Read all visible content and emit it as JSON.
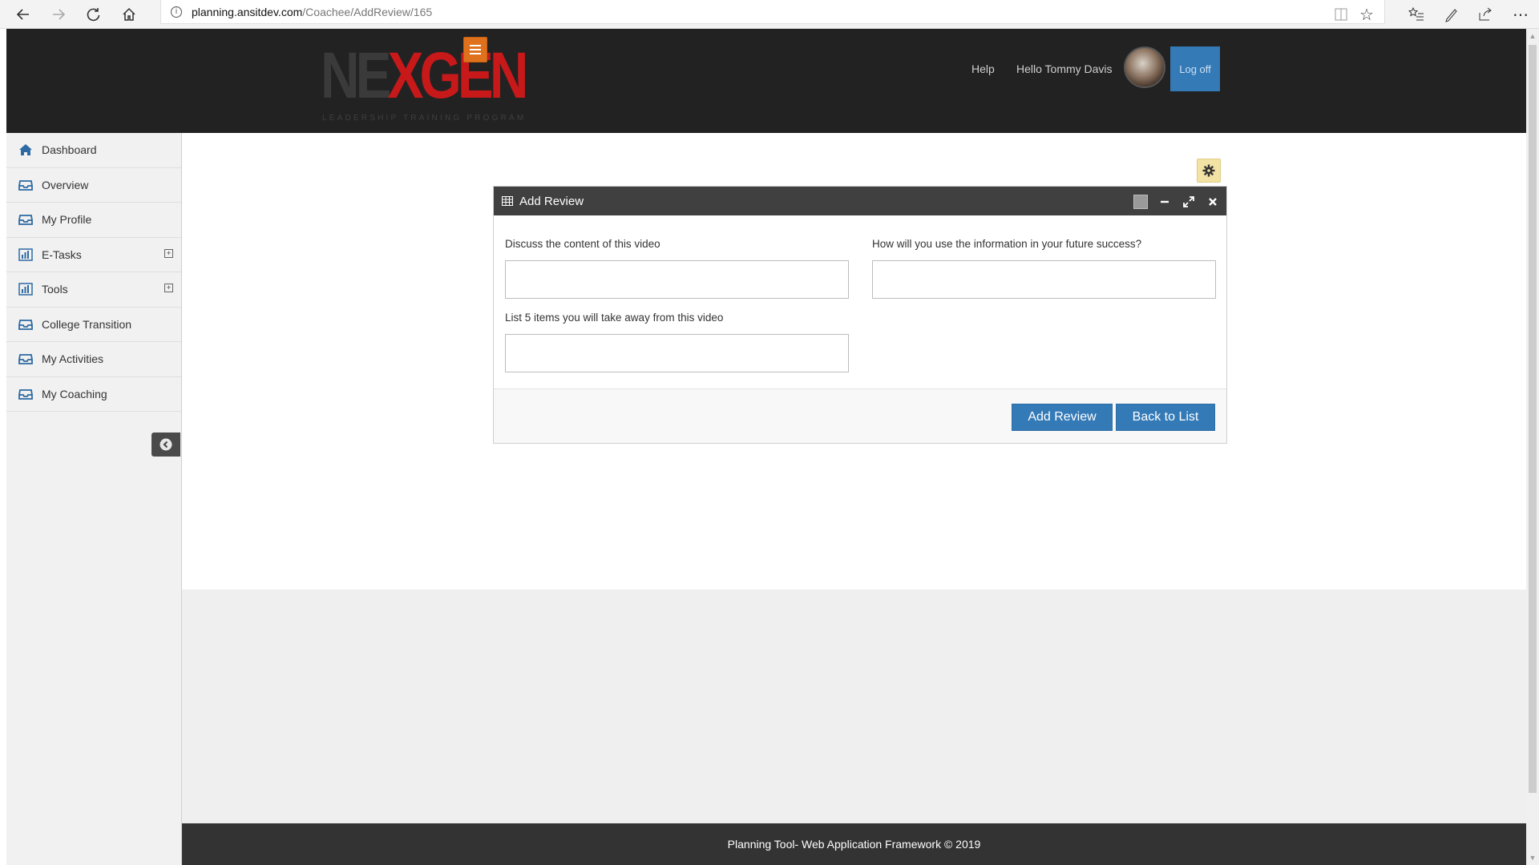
{
  "browser": {
    "url_domain": "planning.ansitdev.com",
    "url_path": "/Coachee/AddReview/165",
    "icons": [
      "back-icon",
      "forward-icon",
      "refresh-icon",
      "home-icon",
      "reading-view-icon",
      "favorite-star-icon",
      "favorites-list-icon",
      "pen-icon",
      "share-icon",
      "more-icon"
    ]
  },
  "header": {
    "logo_part1": "NE",
    "logo_part2": "X",
    "logo_part3": "GEN",
    "logo_subtitle": "LEADERSHIP TRAINING PROGRAM",
    "help_label": "Help",
    "greeting": "Hello Tommy Davis",
    "logoff_label": "Log off",
    "accent_color": "#e0711c",
    "brand_red": "#c8191a"
  },
  "sidebar": {
    "items": [
      {
        "label": "Dashboard",
        "icon": "home-icon"
      },
      {
        "label": "Overview",
        "icon": "inbox-icon"
      },
      {
        "label": "My Profile",
        "icon": "inbox-icon"
      },
      {
        "label": "E-Tasks",
        "icon": "bar-chart-icon",
        "expandable": true
      },
      {
        "label": "Tools",
        "icon": "bar-chart-icon",
        "expandable": true
      },
      {
        "label": "College Transition",
        "icon": "inbox-icon"
      },
      {
        "label": "My Activities",
        "icon": "inbox-icon"
      },
      {
        "label": "My Coaching",
        "icon": "inbox-icon"
      }
    ]
  },
  "panel": {
    "title": "Add Review",
    "fields": {
      "discuss_label": "Discuss the content of this video",
      "discuss_value": "",
      "future_label": "How will you use the information in your future success?",
      "future_value": "",
      "list_label": "List 5 items you will take away from this video",
      "list_value": ""
    },
    "add_button": "Add Review",
    "back_button": "Back to List"
  },
  "footer": {
    "text": "Planning Tool- Web Application Framework © 2019"
  },
  "colors": {
    "primary_button": "#337ab7",
    "header_bg": "#222222",
    "panel_header_bg": "#404040",
    "footer_bg": "#333333"
  }
}
